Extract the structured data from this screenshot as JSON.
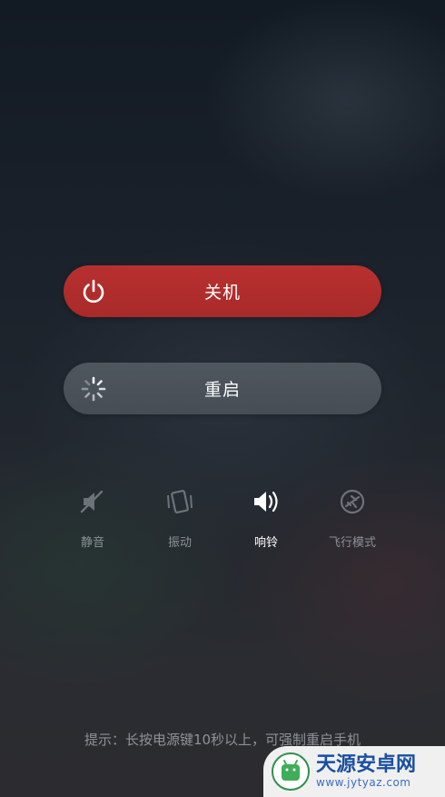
{
  "power_menu": {
    "shutdown_label": "关机",
    "restart_label": "重启"
  },
  "sound_modes": [
    {
      "label": "静音",
      "icon": "mute-icon",
      "active": false
    },
    {
      "label": "振动",
      "icon": "vibrate-icon",
      "active": false
    },
    {
      "label": "响铃",
      "icon": "ring-icon",
      "active": true
    },
    {
      "label": "飞行模式",
      "icon": "airplane-icon",
      "active": false
    }
  ],
  "hint": "提示：长按电源键10秒以上，可强制重启手机",
  "watermark": {
    "title": "天源安卓网",
    "url": "www.jytyaz.com"
  },
  "colors": {
    "shutdown": "#b02d2c",
    "restart": "#4a5159",
    "active_label": "#ffffff",
    "inactive_label": "#8b9097"
  }
}
